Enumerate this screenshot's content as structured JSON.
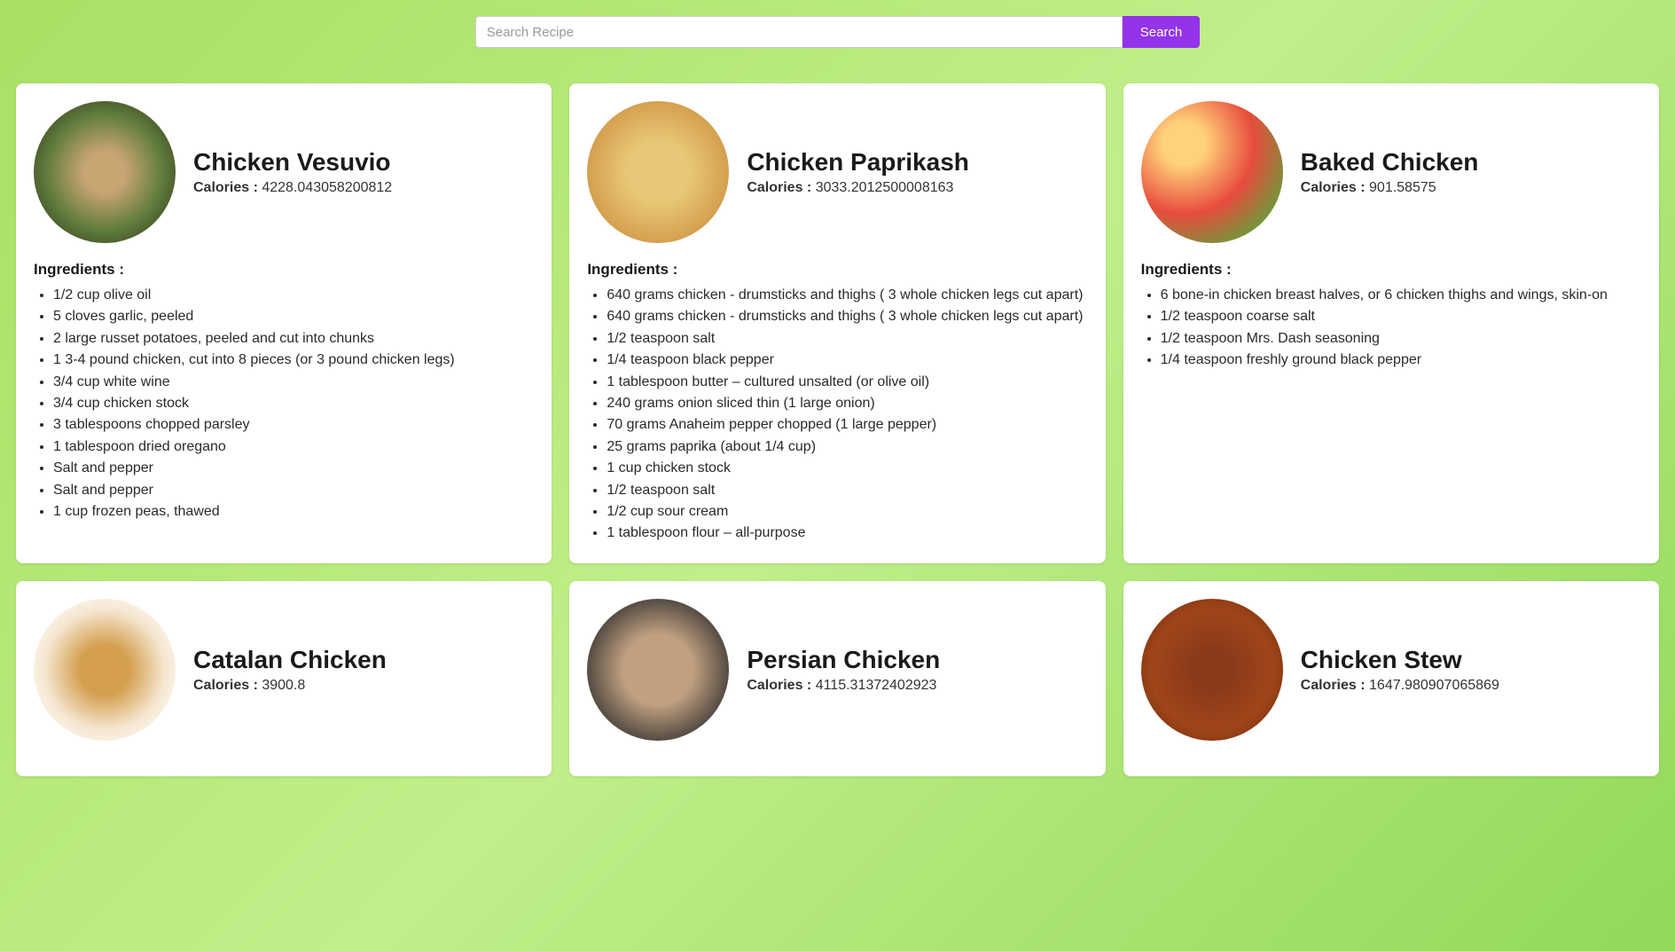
{
  "search": {
    "placeholder": "Search Recipe",
    "button_label": "Search"
  },
  "labels": {
    "calories": "Calories : ",
    "ingredients": "Ingredients :"
  },
  "recipes": [
    {
      "title": "Chicken Vesuvio",
      "calories": "4228.043058200812",
      "image_class": "img-vesuvio",
      "ingredients": [
        "1/2 cup olive oil",
        "5 cloves garlic, peeled",
        "2 large russet potatoes, peeled and cut into chunks",
        "1 3-4 pound chicken, cut into 8 pieces (or 3 pound chicken legs)",
        "3/4 cup white wine",
        "3/4 cup chicken stock",
        "3 tablespoons chopped parsley",
        "1 tablespoon dried oregano",
        "Salt and pepper",
        "Salt and pepper",
        "1 cup frozen peas, thawed"
      ]
    },
    {
      "title": "Chicken Paprikash",
      "calories": "3033.2012500008163",
      "image_class": "img-paprikash",
      "ingredients": [
        "640 grams chicken - drumsticks and thighs ( 3 whole chicken legs cut apart)",
        "640 grams chicken - drumsticks and thighs ( 3 whole chicken legs cut apart)",
        "1/2 teaspoon salt",
        "1/4 teaspoon black pepper",
        "1 tablespoon butter – cultured unsalted (or olive oil)",
        "240 grams onion sliced thin (1 large onion)",
        "70 grams Anaheim pepper chopped (1 large pepper)",
        "25 grams paprika (about 1/4 cup)",
        "1 cup chicken stock",
        "1/2 teaspoon salt",
        "1/2 cup sour cream",
        "1 tablespoon flour – all-purpose"
      ]
    },
    {
      "title": "Baked Chicken",
      "calories": "901.58575",
      "image_class": "img-baked",
      "ingredients": [
        "6 bone-in chicken breast halves, or 6 chicken thighs and wings, skin-on",
        "1/2 teaspoon coarse salt",
        "1/2 teaspoon Mrs. Dash seasoning",
        "1/4 teaspoon freshly ground black pepper"
      ]
    },
    {
      "title": "Catalan Chicken",
      "calories": "3900.8",
      "image_class": "img-catalan",
      "ingredients": []
    },
    {
      "title": "Persian Chicken",
      "calories": "4115.31372402923",
      "image_class": "img-persian",
      "ingredients": []
    },
    {
      "title": "Chicken Stew",
      "calories": "1647.980907065869",
      "image_class": "img-stew",
      "ingredients": []
    }
  ]
}
